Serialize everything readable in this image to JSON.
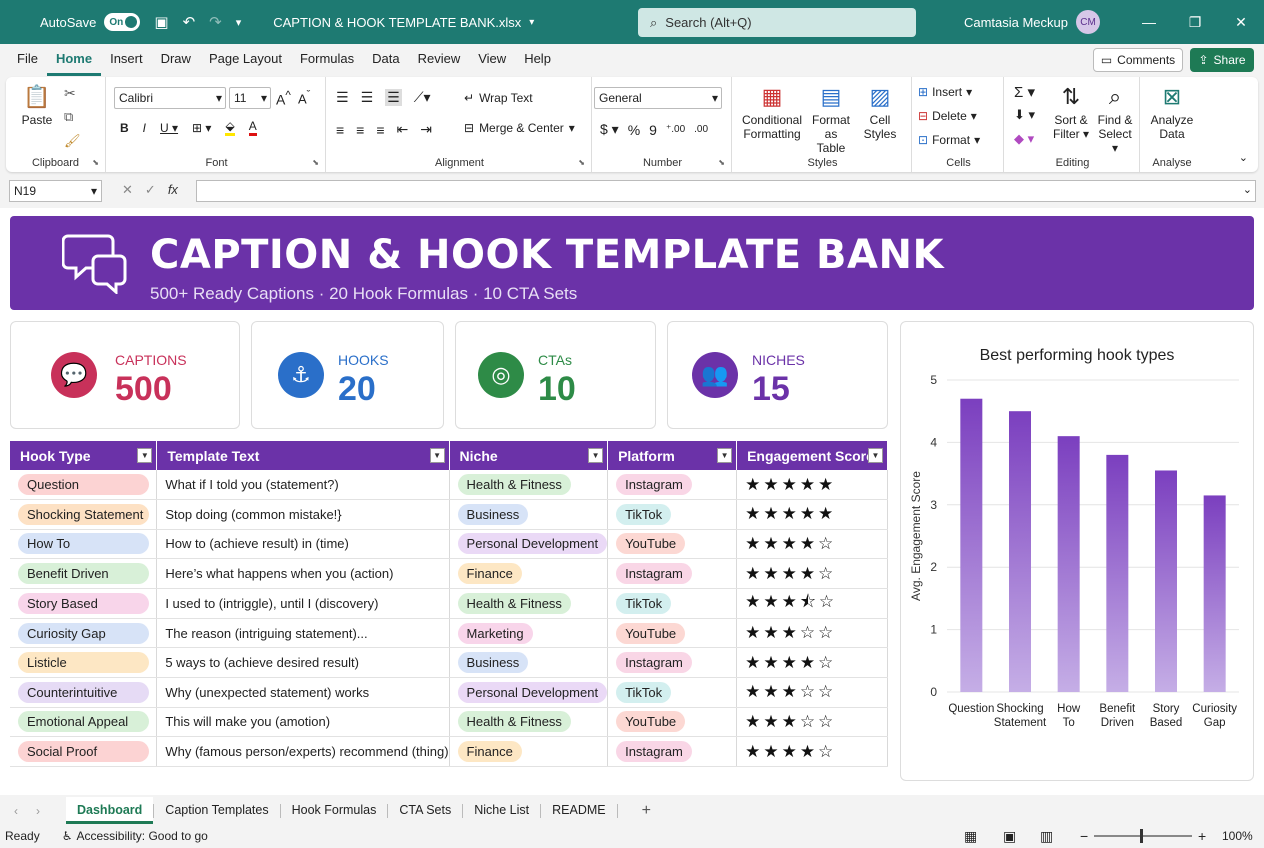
{
  "titlebar": {
    "autosave": "AutoSave",
    "toggle": "On",
    "filename": "CAPTION & HOOK TEMPLATE BANK.xlsx",
    "search": "Search (Alt+Q)",
    "user": "Camtasia Meckup",
    "initials": "CM"
  },
  "menu": [
    "File",
    "Home",
    "Insert",
    "Draw",
    "Page Layout",
    "Formulas",
    "Data",
    "Review",
    "View",
    "Help"
  ],
  "comments": "Comments",
  "share": "Share",
  "ribbon": {
    "clipboard": {
      "label": "Clipboard",
      "paste": "Paste"
    },
    "font": {
      "label": "Font",
      "name": "Calibri",
      "size": "11"
    },
    "alignment": {
      "label": "Alignment",
      "wrap": "Wrap Text",
      "merge": "Merge & Center"
    },
    "number": {
      "label": "Number",
      "format": "General"
    },
    "styles": {
      "label": "Styles",
      "cond1": "Conditional",
      "cond2": "Formatting",
      "fmt1": "Format as",
      "fmt2": "Table",
      "cell1": "Cell",
      "cell2": "Styles"
    },
    "cells": {
      "label": "Cells",
      "insert": "Insert",
      "delete": "Delete",
      "format": "Format"
    },
    "editing": {
      "label": "Editing",
      "sort1": "Sort &",
      "sort2": "Filter",
      "find1": "Find &",
      "find2": "Select"
    },
    "analyse": {
      "label": "Analyse",
      "a1": "Analyze",
      "a2": "Data"
    }
  },
  "namebox": "N19",
  "banner": {
    "title": "CAPTION & HOOK TEMPLATE BANK",
    "subtitle": "500+ Ready Captions · 20 Hook Formulas · 10 CTA Sets"
  },
  "cards": [
    {
      "label": "CAPTIONS",
      "value": "500",
      "color": "#c8315a",
      "icon": "chat-icon"
    },
    {
      "label": "HOOKS",
      "value": "20",
      "color": "#2a6fc9",
      "icon": "hook-icon"
    },
    {
      "label": "CTAs",
      "value": "10",
      "color": "#2e8b47",
      "icon": "target-icon"
    },
    {
      "label": "NICHES",
      "value": "15",
      "color": "#6b32a8",
      "icon": "people-icon"
    }
  ],
  "table": {
    "headers": [
      "Hook Type",
      "Template Text",
      "Niche",
      "Platform",
      "Engagement Score"
    ],
    "rows": [
      {
        "hook": "Question",
        "text": "What if I told you (statement?)",
        "niche": "Health & Fitness",
        "platform": "Instagram",
        "rating": 5
      },
      {
        "hook": "Shocking Statement",
        "text": "Stop doing (common mistake!}",
        "niche": "Business",
        "platform": "TikTok",
        "rating": 5
      },
      {
        "hook": "How To",
        "text": "How to (achieve result) in (time)",
        "niche": "Personal Development",
        "platform": "YouTube",
        "rating": 4
      },
      {
        "hook": "Benefit Driven",
        "text": "Here’s what happens when you (action)",
        "niche": "Finance",
        "platform": "Instagram",
        "rating": 4
      },
      {
        "hook": "Story Based",
        "text": "I used to (intriggle), until I (discovery)",
        "niche": "Health & Fitness",
        "platform": "TikTok",
        "rating": 3.5
      },
      {
        "hook": "Curiosity Gap",
        "text": "The reason (intriguing statement)...",
        "niche": "Marketing",
        "platform": "YouTube",
        "rating": 3
      },
      {
        "hook": "Listicle",
        "text": "5 ways to (achieve desired result)",
        "niche": "Business",
        "platform": "Instagram",
        "rating": 4
      },
      {
        "hook": "Counterintuitive",
        "text": "Why (unexpected statement) works",
        "niche": "Personal Development",
        "platform": "TikTok",
        "rating": 3
      },
      {
        "hook": "Emotional Appeal",
        "text": "This will make you (amotion)",
        "niche": "Health & Fitness",
        "platform": "YouTube",
        "rating": 3
      },
      {
        "hook": "Social Proof",
        "text": "Why (famous person/experts) recommend (thing)",
        "niche": "Finance",
        "platform": "Instagram",
        "rating": 4
      }
    ]
  },
  "chart_data": {
    "type": "bar",
    "title": "Best performing hook types",
    "ylabel": "Avg. Engagement Score",
    "xlabel": "",
    "categories": [
      "Question",
      "Shocking Statement",
      "How To",
      "Benefit Driven",
      "Story Based",
      "Curiosity Gap"
    ],
    "values": [
      4.7,
      4.5,
      4.1,
      3.8,
      3.55,
      3.15
    ],
    "ylim": [
      0,
      5
    ],
    "yticks": [
      0,
      1,
      2,
      3,
      4,
      5
    ],
    "grid": true
  },
  "tabs": [
    "Dashboard",
    "Caption Templates",
    "Hook Formulas",
    "CTA Sets",
    "Niche List",
    "README"
  ],
  "status": {
    "ready": "Ready",
    "accessibility": "Accessibility: Good to go",
    "zoom": "100%"
  }
}
